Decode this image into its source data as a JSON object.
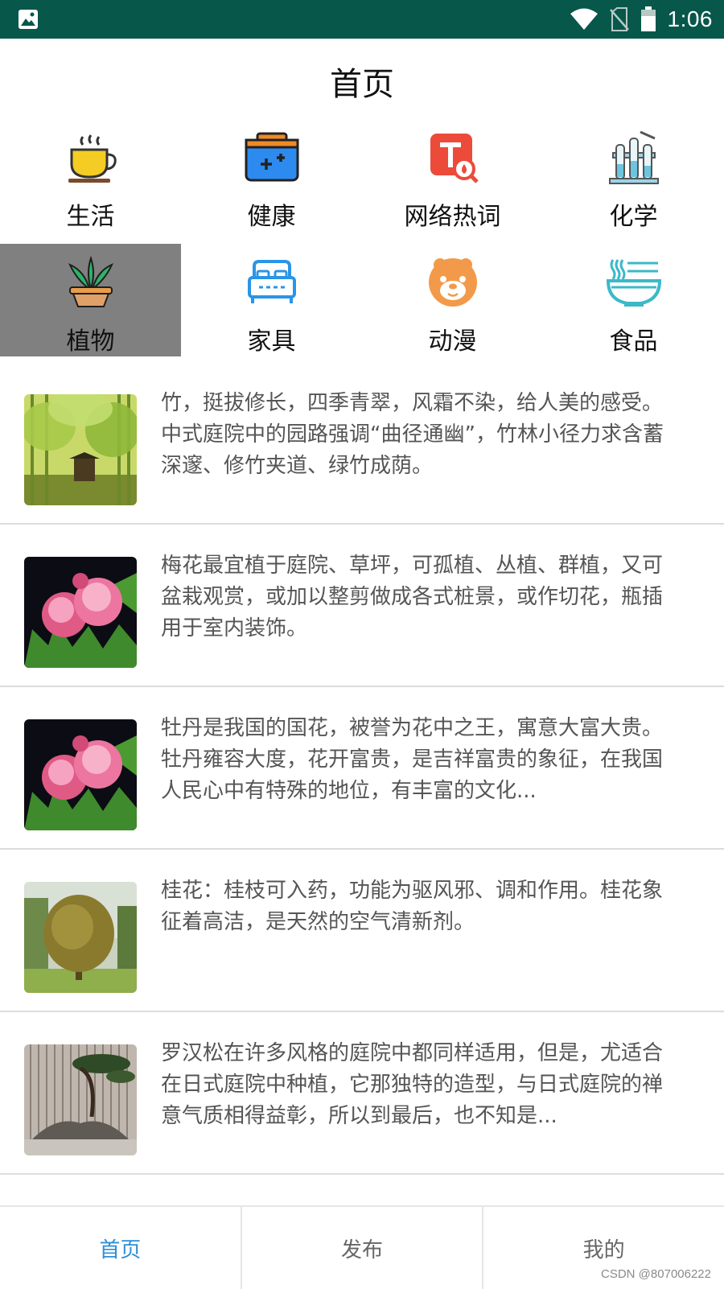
{
  "status_bar": {
    "time": "1:06",
    "icons": [
      "image-icon",
      "wifi-icon",
      "no-sim-icon",
      "battery-icon"
    ],
    "background": "#07574a"
  },
  "page_title": "首页",
  "categories": [
    {
      "label": "生活",
      "icon": "coffee-cup-icon"
    },
    {
      "label": "健康",
      "icon": "medical-kit-icon"
    },
    {
      "label": "网络热词",
      "icon": "hot-word-search-icon"
    },
    {
      "label": "化学",
      "icon": "test-tubes-icon"
    },
    {
      "label": "植物",
      "icon": "potted-plant-icon",
      "selected": true
    },
    {
      "label": "家具",
      "icon": "bed-icon"
    },
    {
      "label": "动漫",
      "icon": "bear-face-icon"
    },
    {
      "label": "食品",
      "icon": "noodle-bowl-icon"
    }
  ],
  "articles": [
    {
      "text": "竹，挺拔修长，四季青翠，风霜不染，给人美的感受。中式庭院中的园路强调“曲径通幽”，竹林小径力求含蓄深邃、修竹夹道、绿竹成荫。",
      "image": "bamboo-garden"
    },
    {
      "text": "梅花最宜植于庭院、草坪，可孤植、丛植、群植，又可盆栽观赏，或加以整剪做成各式桩景，或作切花，瓶插用于室内装饰。",
      "image": "pink-flower"
    },
    {
      "text": "牡丹是我国的国花，被誉为花中之王，寓意大富大贵。牡丹雍容大度，花开富贵，是吉祥富贵的象征，在我国人民心中有特殊的地位，有丰富的文化...",
      "image": "pink-flower"
    },
    {
      "text": "桂花：桂枝可入药，功能为驱风邪、调和作用。桂花象征着高洁，是天然的空气清新剂。",
      "image": "osmanthus-tree"
    },
    {
      "text": "罗汉松在许多风格的庭院中都同样适用，但是，尤适合在日式庭院中种植，它那独特的造型，与日式庭院的禅意气质相得益彰，所以到最后，也不知是...",
      "image": "pine-rock-garden"
    }
  ],
  "tabs": [
    {
      "label": "首页",
      "active": true
    },
    {
      "label": "发布"
    },
    {
      "label": "我的"
    }
  ],
  "accent_color": "#2e8fd6",
  "watermark": "CSDN @807006222"
}
